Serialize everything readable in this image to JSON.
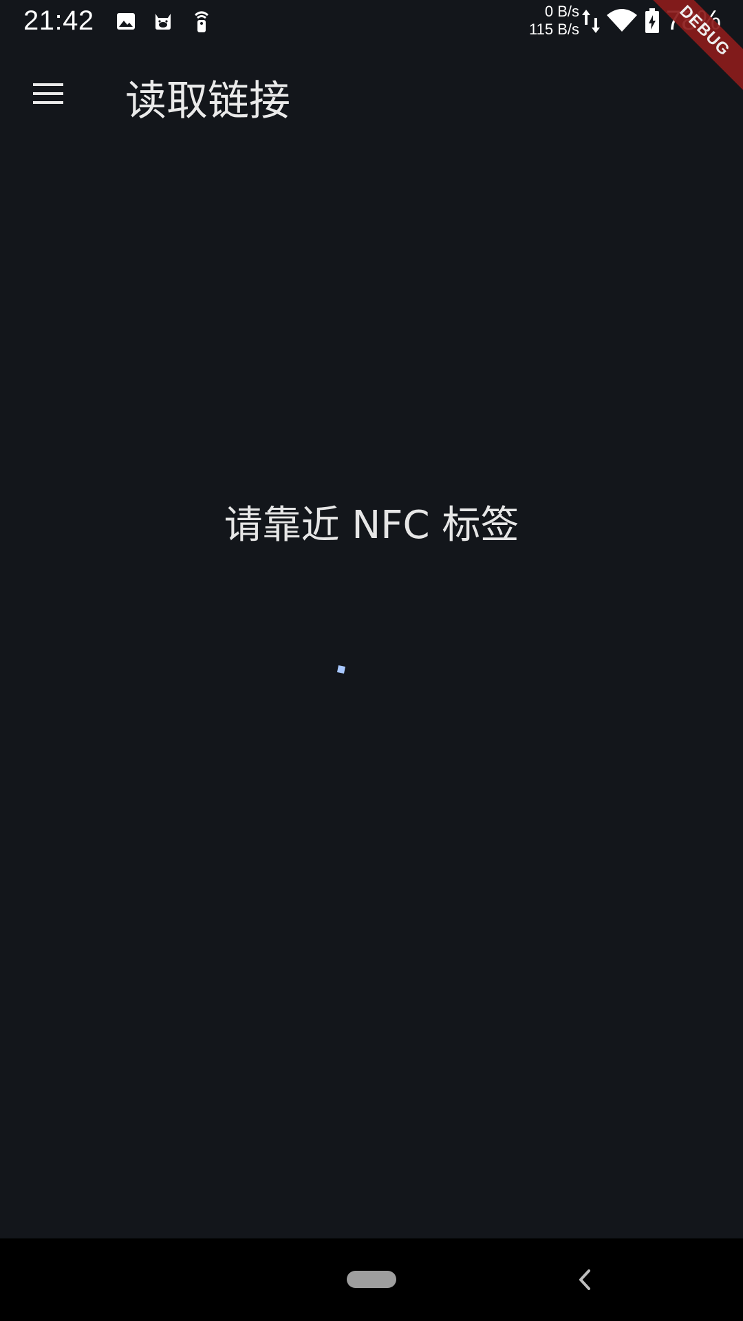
{
  "status_bar": {
    "time": "21:42",
    "net_up": "0 B/s",
    "net_down": "115 B/s",
    "battery_percent": "78%",
    "icons": [
      "image-icon",
      "app-notification-icon",
      "remote-icon",
      "data-arrows-icon",
      "wifi-icon",
      "battery-charging-icon"
    ]
  },
  "debug_banner": "DEBUG",
  "app_bar": {
    "title": "读取链接",
    "menu_icon": "hamburger-menu-icon"
  },
  "main": {
    "prompt": "请靠近 NFC 标签",
    "progress": "loading-spinner"
  },
  "nav_bar": {
    "home_icon": "home-pill",
    "back_icon": "back-chevron-icon"
  },
  "colors": {
    "background": "#13161b",
    "nav_background": "#000000",
    "spinner_accent": "#a8c8ff",
    "debug_banner": "#8b1c1c"
  }
}
